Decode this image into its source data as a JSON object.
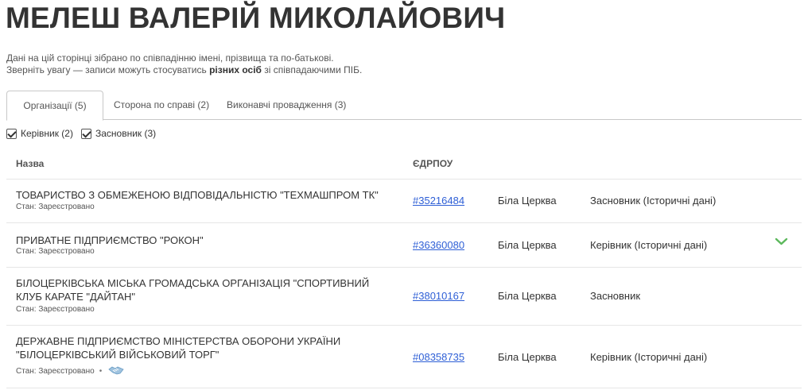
{
  "page": {
    "title": "МЕЛЕШ ВАЛЕРІЙ МИКОЛАЙОВИЧ",
    "notice_line1": "Дані на цій сторінці зібрано по співпадінню імені, прізвища та по-батькові.",
    "notice_line2_pre": "Зверніть увагу — записи можуть стосуватись ",
    "notice_line2_bold": "різних осіб",
    "notice_line2_post": " зі співпадаючими ПІБ."
  },
  "tabs": [
    {
      "label": "Організації (5)",
      "active": true
    },
    {
      "label": "Сторона по справі (2)",
      "active": false
    },
    {
      "label": "Виконавчі провадження (3)",
      "active": false
    }
  ],
  "filters": [
    {
      "label": "Керівник (2)",
      "checked": true
    },
    {
      "label": "Засновник (3)",
      "checked": true
    }
  ],
  "table": {
    "headers": {
      "name": "Назва",
      "code": "ЄДРПОУ"
    },
    "rows": [
      {
        "name": "ТОВАРИСТВО З ОБМЕЖЕНОЮ ВІДПОВІДАЛЬНІСТЮ \"ТЕХМАШПРОМ ТК\"",
        "status": "Стан: Зареєстровано",
        "code": "#35216484",
        "city": "Біла Церква",
        "role": "Засновник (Історичні дані)"
      },
      {
        "name": "ПРИВАТНЕ ПІДПРИЄМСТВО \"РОКОН\"",
        "status": "Стан: Зареєстровано",
        "code": "#36360080",
        "city": "Біла Церква",
        "role": "Керівник (Історичні дані)"
      },
      {
        "name": "БІЛОЦЕРКІВСЬКА МІСЬКА ГРОМАДСЬКА ОРГАНІЗАЦІЯ \"СПОРТИВНИЙ КЛУБ КАРАТЕ \"ДАЙТАН\"",
        "status": "Стан: Зареєстровано",
        "code": "#38010167",
        "city": "Біла Церква",
        "role": "Засновник"
      },
      {
        "name": "ДЕРЖАВНЕ ПІДПРИЄМСТВО МІНІСТЕРСТВА ОБОРОНИ УКРАЇНИ \"БІЛОЦЕРКІВСЬКИЙ ВІЙСЬКОВИЙ ТОРГ\"",
        "status": "Стан: Зареєстровано",
        "code": "#08358735",
        "city": "Біла Церква",
        "role": "Керівник (Історичні дані)"
      }
    ]
  },
  "icons": {
    "expand": "chevron-down-icon",
    "handshake": "handshake-icon",
    "accent_color": "#5cb85c",
    "link_color": "#2e5fd6"
  }
}
